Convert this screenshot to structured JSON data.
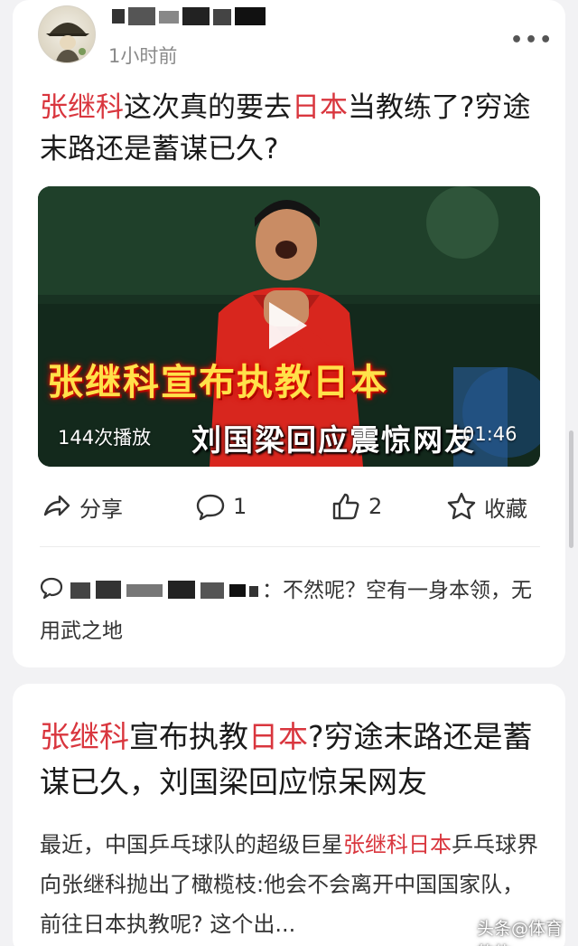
{
  "post": {
    "timestamp": "1小时前",
    "more_label": "•••",
    "headline_parts": [
      "张继科",
      "这次真的要去",
      "日本",
      "当教练了?穷途末路还是蓄谋已久?"
    ]
  },
  "video": {
    "overlay_title": "张继科宣布执教日本",
    "overlay_subtitle": "刘国梁回应震惊网友",
    "play_count": "144次播放",
    "duration": "01:46"
  },
  "actions": {
    "share": "分享",
    "comment_count": "1",
    "like_count": "2",
    "favorite": "收藏"
  },
  "comment": {
    "separator": "：",
    "text": "不然呢？空有一身本领，无用武之地"
  },
  "article": {
    "title_parts": [
      "张继科",
      "宣布执教",
      "日本",
      "?穷途末路还是蓄谋已久，刘国梁回应惊呆网友"
    ],
    "body_prefix": "最近，中国乒乓球队的超级巨星",
    "body_highlight": "张继科日本",
    "body_suffix": "乒乓球界向张继科抛出了橄榄枝:他会不会离开中国国家队，前往日本执教呢? 这个出...",
    "watermark": "头条@体育的体"
  },
  "colors": {
    "highlight_red": "#d9363e",
    "background": "#f2f2f4",
    "card": "#ffffff"
  }
}
